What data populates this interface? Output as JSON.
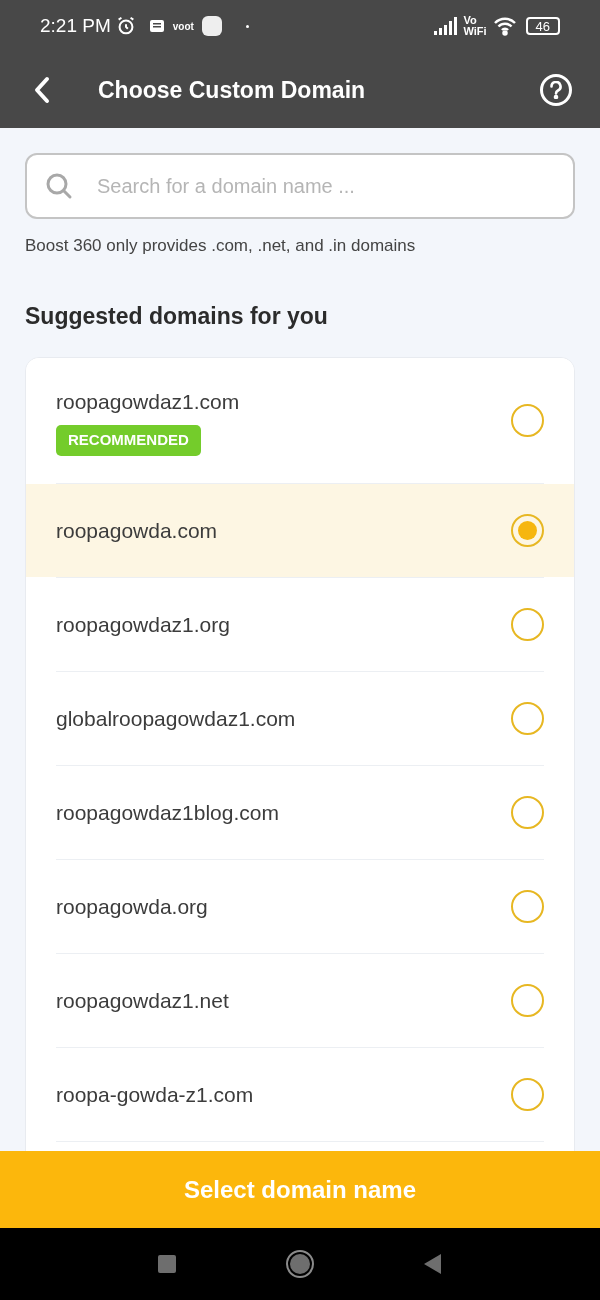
{
  "status_bar": {
    "time": "2:21 PM",
    "app_badge": "voot",
    "network": "Vo WiFi",
    "battery": "46"
  },
  "header": {
    "title": "Choose Custom Domain"
  },
  "search": {
    "placeholder": "Search for a domain name ..."
  },
  "hint": "Boost 360 only provides .com, .net, and .in domains",
  "section_title": "Suggested domains for you",
  "domains": [
    {
      "name": "roopagowdaz1.com",
      "badge": "RECOMMENDED",
      "selected": false
    },
    {
      "name": "roopagowda.com",
      "selected": true
    },
    {
      "name": "roopagowdaz1.org",
      "selected": false
    },
    {
      "name": "globalroopagowdaz1.com",
      "selected": false
    },
    {
      "name": "roopagowdaz1blog.com",
      "selected": false
    },
    {
      "name": "roopagowda.org",
      "selected": false
    },
    {
      "name": "roopagowdaz1.net",
      "selected": false
    },
    {
      "name": "roopa-gowda-z1.com",
      "selected": false
    }
  ],
  "primary_button": "Select domain name"
}
